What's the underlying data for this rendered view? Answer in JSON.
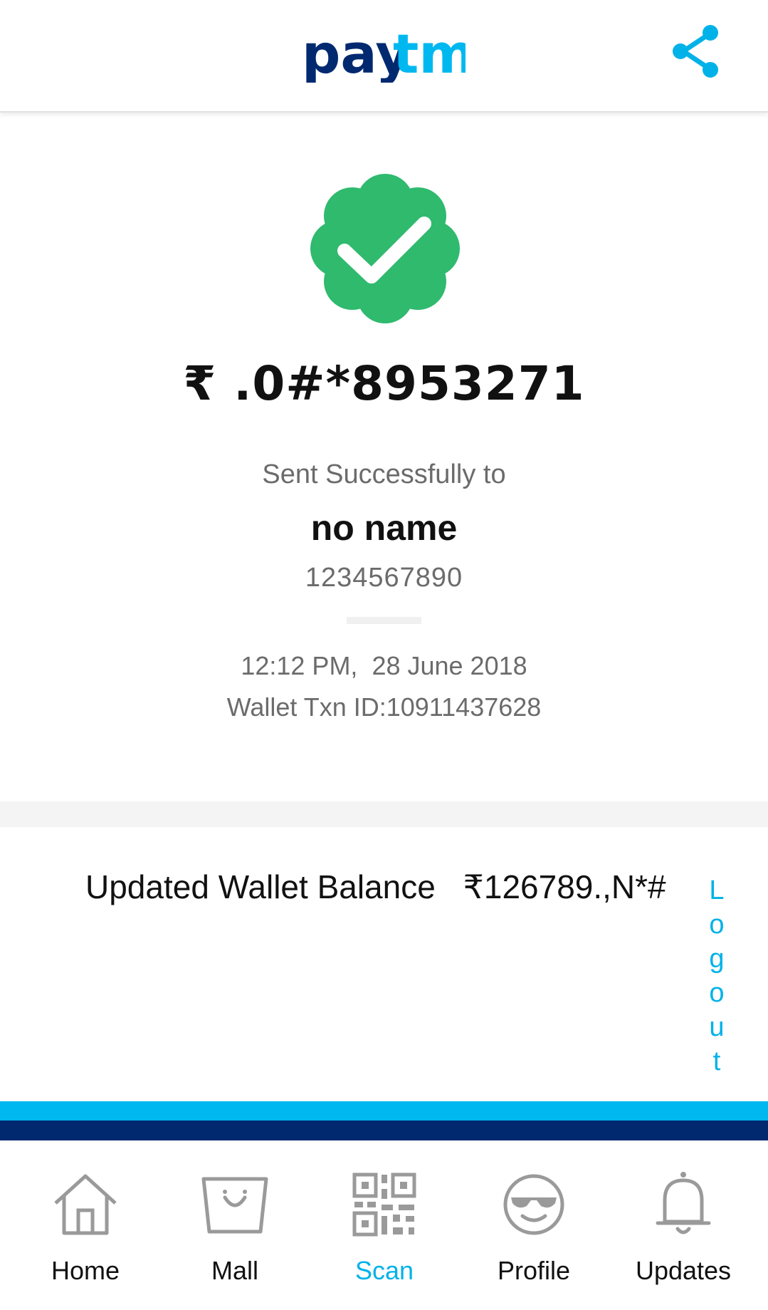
{
  "header": {
    "logo_text": "paytm",
    "share_icon": "share-icon"
  },
  "colors": {
    "brand_dark": "#002970",
    "brand_light": "#00b8f0",
    "success_green": "#2fba6e",
    "link_blue": "#00b2e8"
  },
  "transaction": {
    "success_icon": "check-badge-icon",
    "amount": "₹ .0#*8953271",
    "sent_label": "Sent Successfully to",
    "recipient_name": "no name",
    "recipient_phone": "1234567890",
    "time": "12:12 PM,  28 June 2018",
    "txn_id": "Wallet Txn ID:10911437628"
  },
  "wallet": {
    "label": "Updated Wallet Balance",
    "balance": "₹126789.,N*#"
  },
  "logout": {
    "label": "Logout"
  },
  "nav": {
    "items": [
      {
        "label": "Home",
        "icon": "home-icon"
      },
      {
        "label": "Mall",
        "icon": "shopping-bag-icon"
      },
      {
        "label": "Scan",
        "icon": "qr-code-icon",
        "active": true
      },
      {
        "label": "Profile",
        "icon": "profile-face-icon"
      },
      {
        "label": "Updates",
        "icon": "bell-icon"
      }
    ]
  }
}
